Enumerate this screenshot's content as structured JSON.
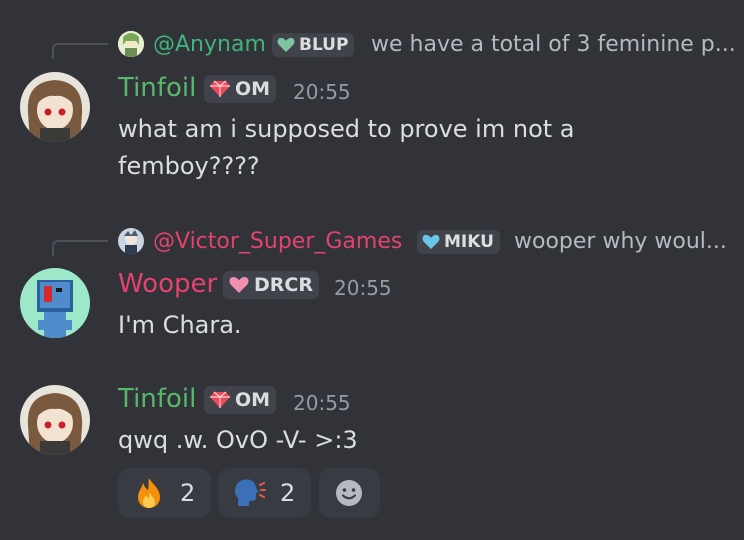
{
  "messages": [
    {
      "reply": {
        "name": "@Anynam",
        "tag": "BLUP",
        "text": "we have a total of 3 feminine p..."
      },
      "author": "Tinfoil",
      "tag": "OM",
      "time": "20:55",
      "lines": [
        "what am i supposed to prove im not a",
        "femboy????"
      ]
    },
    {
      "reply": {
        "name": "@Victor_Super_Games",
        "tag": "MIKU",
        "text": "wooper why woul..."
      },
      "author": "Wooper",
      "tag": "DRCR",
      "time": "20:55",
      "lines": [
        "I'm Chara."
      ]
    },
    {
      "author": "Tinfoil",
      "tag": "OM",
      "time": "20:55",
      "lines": [
        "qwq .w. OvO -V- >:3"
      ],
      "reactions": [
        {
          "icon": "fire-emoji",
          "count": "2"
        },
        {
          "icon": "speaking-head-emoji",
          "count": "2"
        }
      ],
      "add_reaction_icon": "add-reaction-icon"
    }
  ],
  "colors": {
    "background": "#313338",
    "tinfoil": "#57b86b",
    "wooper": "#e5426f",
    "reply_name": "#40b47a",
    "timestamp": "#949ba4"
  }
}
